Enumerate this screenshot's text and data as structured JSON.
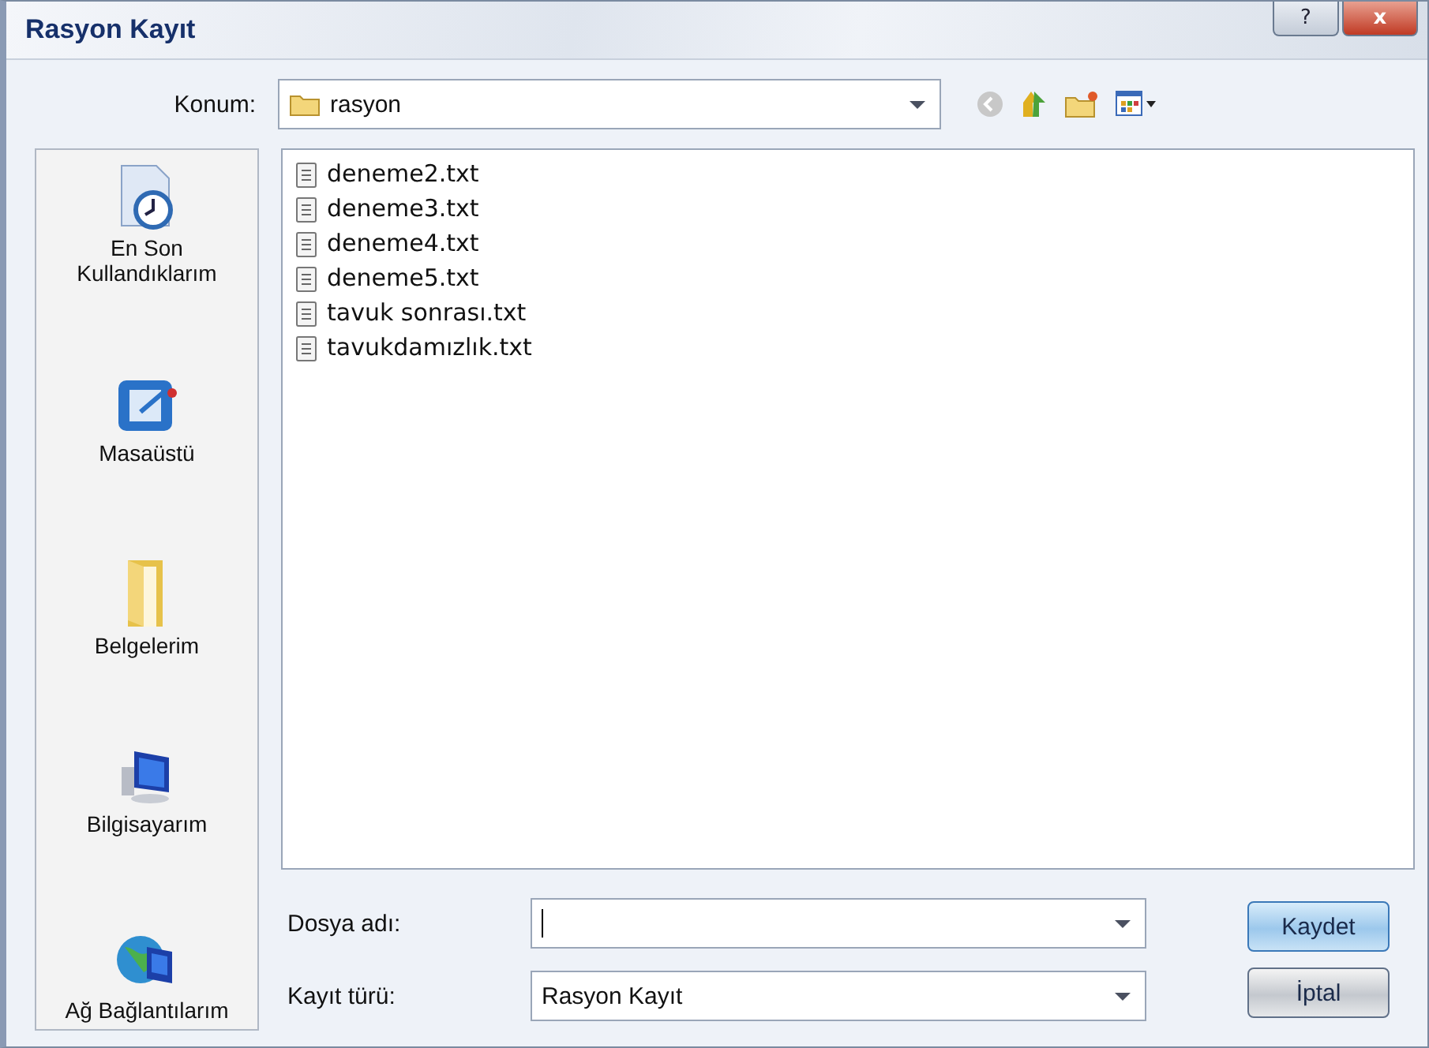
{
  "window": {
    "title": "Rasyon Kayıt",
    "controls": [
      "?",
      "x"
    ]
  },
  "location": {
    "label": "Konum:",
    "value": "rasyon"
  },
  "places": [
    {
      "kind": "recent",
      "label": "En Son Kullandıklarım"
    },
    {
      "kind": "desktop",
      "label": "Masaüstü"
    },
    {
      "kind": "documents",
      "label": "Belgelerim"
    },
    {
      "kind": "computer",
      "label": "Bilgisayarım"
    },
    {
      "kind": "network",
      "label": "Ağ Bağlantılarım"
    }
  ],
  "files": [
    {
      "name": "deneme2.txt"
    },
    {
      "name": "deneme3.txt"
    },
    {
      "name": "deneme4.txt"
    },
    {
      "name": "deneme5.txt"
    },
    {
      "name": "tavuk sonrası.txt"
    },
    {
      "name": "tavukdamızlık.txt"
    }
  ],
  "file_name": {
    "label": "Dosya adı:"
  },
  "file_type": {
    "label": "Kayıt türü:",
    "value": "Rasyon Kayıt"
  },
  "buttons": [
    {
      "kind": "primary",
      "label": "Kaydet"
    },
    {
      "kind": "secondary",
      "label": "İptal"
    }
  ]
}
